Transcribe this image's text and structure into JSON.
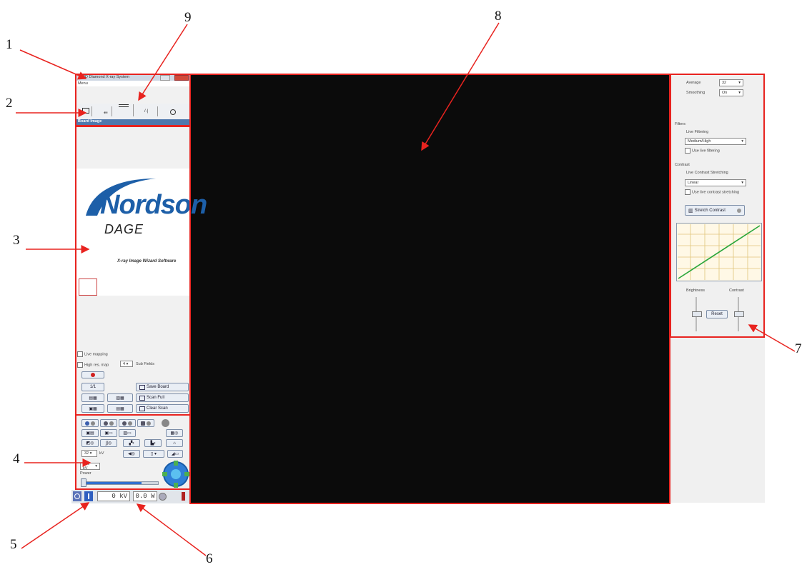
{
  "callouts": {
    "n1": "1",
    "n2": "2",
    "n3": "3",
    "n4": "4",
    "n5": "5",
    "n6": "6",
    "n7": "7",
    "n8": "8",
    "n9": "9"
  },
  "window": {
    "title": "2D Diamond X-ray System",
    "menu": "Menu"
  },
  "panel_header": "Board Image",
  "brand": {
    "name": "Nordson",
    "sub": "DAGE",
    "tagline": "X-ray Image Wizard Software"
  },
  "left_options": {
    "live_mapping": "Live mapping",
    "high_res_map": "High res. map",
    "grid_value": "4",
    "grid_label": "Sub Fields",
    "board_count": "1/1",
    "save_board": "Save Board",
    "scan_full": "Scan Full",
    "clear_scan": "Clear Scan"
  },
  "controls": {
    "zoom_value": "32",
    "zoom_unit": "kV",
    "kv_select": "120 kV",
    "power_label": "Power",
    "power_fraction": 0.78
  },
  "status": {
    "kv": "0 kV",
    "w": "0.0 W"
  },
  "right_panel": {
    "average_label": "Average",
    "average_value": "32",
    "smoothing_label": "Smoothing",
    "smoothing_value": "On",
    "filters_label": "Filters",
    "live_filtering_label": "Live Filtering",
    "live_filtering_value": "Medium/High",
    "use_live_filtering": "Use live filtering",
    "contrast_label": "Contrast",
    "live_contrast_label": "Live Contrast Stretching",
    "contrast_value": "Linear",
    "use_live_contrast": "Use live contrast stretching",
    "stretch_button": "Stretch Contrast",
    "brightness_label": "Brightness",
    "contrast_slider_label": "Contrast",
    "reset_button": "Reset"
  },
  "colors": {
    "callout_red": "#e8231f",
    "image_bg": "#0b0b0b",
    "brand_blue": "#1d5fa8",
    "curve_green": "#2aa63a"
  }
}
